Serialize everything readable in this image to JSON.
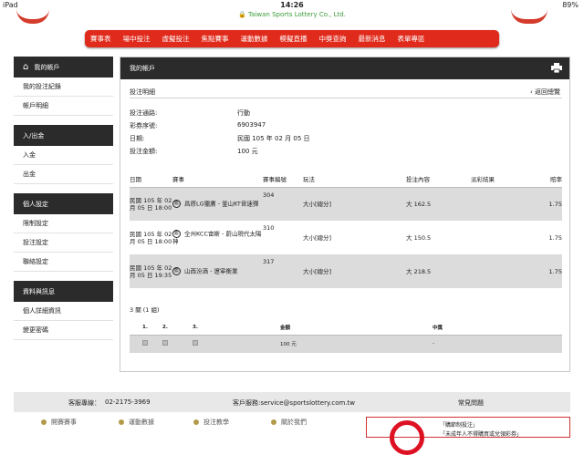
{
  "statusbar": {
    "device": "iPad",
    "time": "14:26",
    "battery": "89%",
    "url": "Taiwan Sports Lottery Co., Ltd."
  },
  "nav": [
    "賽事表",
    "場中投注",
    "虛擬投注",
    "焦點賽事",
    "運動數據",
    "模擬直播",
    "中獎查詢",
    "最新消息",
    "表單專區"
  ],
  "sidebar": {
    "sections": [
      {
        "header": "我的帳戶",
        "items": [
          "我的投注紀錄",
          "帳戶明細"
        ]
      },
      {
        "header": "入/出金",
        "items": [
          "入金",
          "出金"
        ]
      },
      {
        "header": "個人設定",
        "items": [
          "限制設定",
          "投注設定",
          "聯絡設定"
        ]
      },
      {
        "header": "資料與訊息",
        "items": [
          "個人詳細資訊",
          "變更密碼"
        ]
      }
    ]
  },
  "main": {
    "header": "我的帳戶",
    "section_title": "投注明細",
    "back_label": "返回總覽",
    "info": [
      {
        "label": "投注通路:",
        "value": "行動"
      },
      {
        "label": "彩券序號:",
        "value": "6903947"
      },
      {
        "label": "日期:",
        "value": "民國 105 年 02 月 05 日"
      },
      {
        "label": "投注金額:",
        "value": "100 元"
      }
    ],
    "table_headers": [
      "日期",
      "賽事",
      "賽事編號",
      "玩法",
      "投注內容",
      "派彩結果",
      "賠率"
    ],
    "rows": [
      {
        "date": "民國 105 年 02 月 05 日 18:00",
        "sport_icon": "籃",
        "match": "昌原LG獵鷹 - 釜山KT音速彈",
        "id": "304",
        "play": "大小[總分]",
        "content": "大 162.5",
        "result": "",
        "odds": "1.75"
      },
      {
        "date": "民國 105 年 02 月 05 日 18:00",
        "sport_icon": "籃",
        "match": "全州KCC宙斯 - 蔚山現代太陽神",
        "id": "310",
        "play": "大小[總分]",
        "content": "大 150.5",
        "result": "",
        "odds": "1.75"
      },
      {
        "date": "民國 105 年 02 月 05 日 19:35",
        "sport_icon": "籃",
        "match": "山西汾酒 - 遼寧衡業",
        "id": "317",
        "play": "大小[總分]",
        "content": "大 218.5",
        "result": "",
        "odds": "1.75"
      }
    ],
    "summary": "3 關 (1 組)",
    "combo_headers": [
      "1.",
      "2.",
      "3.",
      "金額",
      "中獎"
    ],
    "combo_row": {
      "amount": "100 元",
      "win": "-"
    }
  },
  "footer": {
    "hotline_label": "客服專線：",
    "hotline": "02-2175-3969",
    "email": "客戶服務:service@sportslottery.com.tw",
    "faq": "常見問題",
    "links": [
      "開賽賽事",
      "運動數據",
      "投注教學",
      "關於我們"
    ],
    "warnings": [
      "「購節制投注」",
      "「未成年人不得購買或兌領彩券」"
    ]
  }
}
